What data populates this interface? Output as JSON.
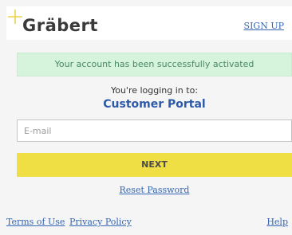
{
  "header": {
    "logo_text": "Gräbert",
    "signup_label": "SIGN UP"
  },
  "status": {
    "success_message": "Your account has been successfully activated"
  },
  "login": {
    "logging_in_to": "You're logging in to:",
    "portal_name": "Customer Portal",
    "email_placeholder": "E-mail",
    "email_value": "",
    "next_label": "NEXT",
    "reset_password_label": "Reset Password"
  },
  "footer": {
    "terms_label": "Terms of Use",
    "privacy_label": "Privacy Policy",
    "help_label": "Help"
  },
  "colors": {
    "brand_yellow": "#efdf45",
    "link_blue": "#3566b4",
    "success_bg": "#d6f3dc",
    "success_text": "#4a8a63"
  }
}
